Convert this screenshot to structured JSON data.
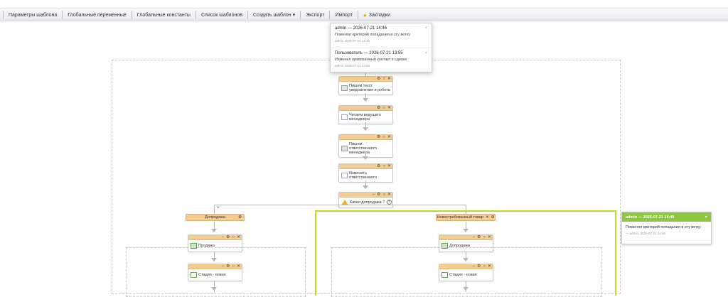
{
  "toolbar": {
    "template_params": "Параметры шаблона",
    "global_vars": "Глобальные переменные",
    "global_consts": "Глобальные константы",
    "template_list": "Список шаблонов",
    "create_template": "Создать шаблон ▾",
    "export": "Экспорт",
    "import": "Импорт",
    "bookmarks": "Закладки"
  },
  "popup": {
    "notes": [
      {
        "title": "admin — 2026-07-21 14:46",
        "text": "Поменял критерий попадания в эту ветку",
        "meta": "admin  2026-07-21 14:46"
      },
      {
        "title": "Пользователь — 2026-07-21 13:55",
        "text": "Изменил привязанный контакт к сделке",
        "meta": "admin  2026-07-21 13:56"
      }
    ]
  },
  "activities": {
    "a1": "Пишем текст уведомления и робота",
    "a2": "Читаем ведущего менеджера",
    "a3": "Пишем ответственного менеджера",
    "a4": "Изменить ответственного",
    "a5": "Какая допродажа ?",
    "left_branch": "Допродажа",
    "right_branch": "Невостребованный товар",
    "l1": "Продажа",
    "l2": "Стадия - новая",
    "r1": "Допродажа",
    "r2": "Стадия - новая",
    "cond_gt": ">"
  },
  "side_note": {
    "title": "admin — 2026-07-21 14:46",
    "text": "Поменял критерий попадания в эту ветку",
    "meta": "— admin, 2026-07-21 14:46",
    "close": "×"
  }
}
